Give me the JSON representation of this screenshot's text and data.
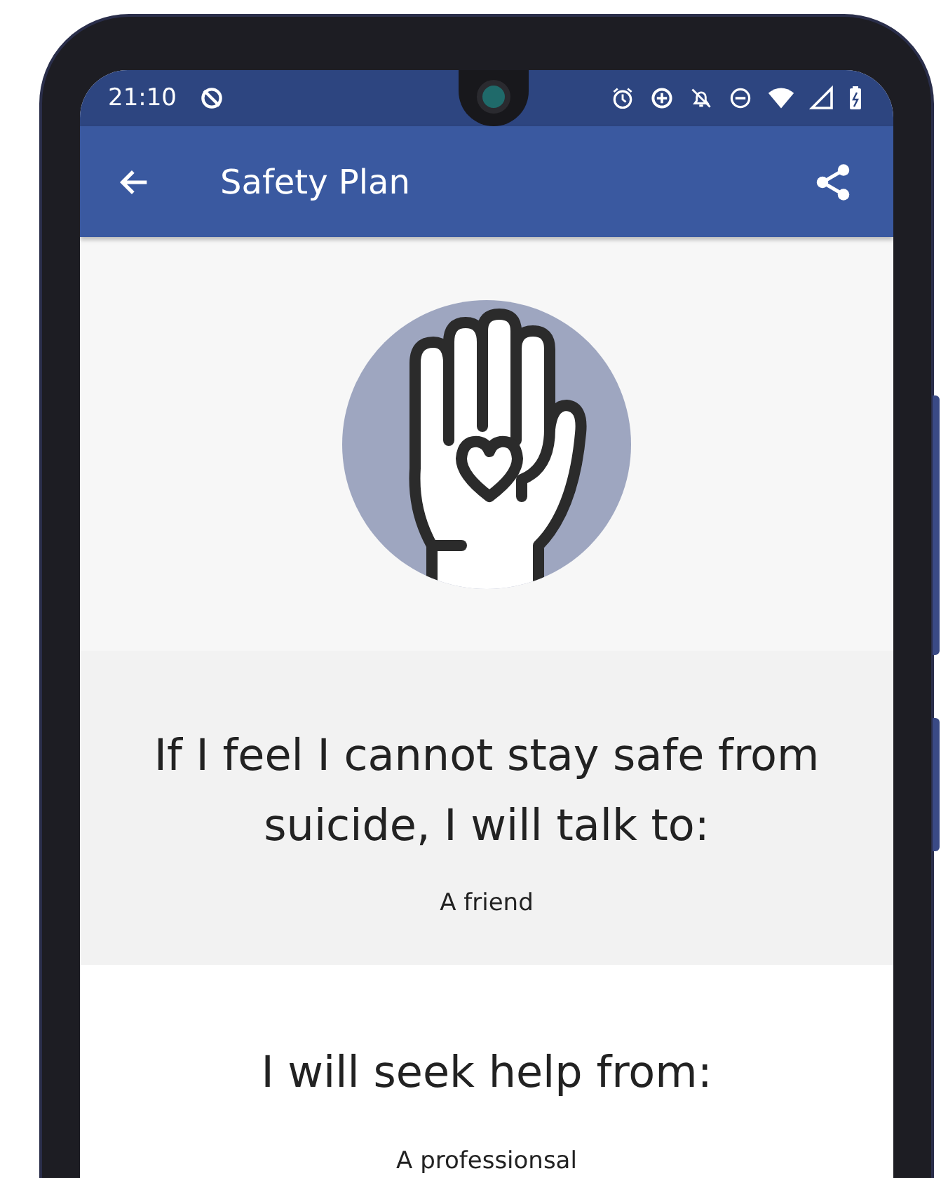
{
  "status_bar": {
    "time": "21:10"
  },
  "app_bar": {
    "title": "Safety Plan"
  },
  "sections": [
    {
      "heading": "If I feel I cannot stay safe from suicide, I will talk to:",
      "answer": "A friend",
      "shaded": true
    },
    {
      "heading": "I will seek help from:",
      "answer": "A professionsal",
      "shaded": false
    }
  ]
}
